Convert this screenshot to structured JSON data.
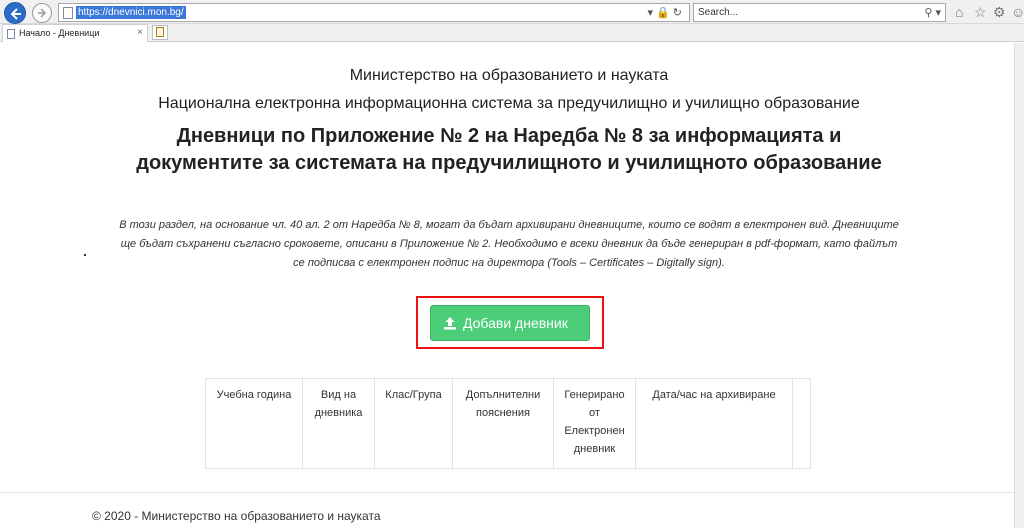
{
  "browser": {
    "url": "https://dnevnici.mon.bg/",
    "search_placeholder": "Search...",
    "tab_title": "Начало - Дневници",
    "tab_close": "×"
  },
  "page": {
    "ministry": "Министерство на образованието и науката",
    "system": "Национална електронна информационна система за предучилищно и училищно образование",
    "heading_line1": "Дневници по Приложение № 2 на Наредба № 8 за информацията и",
    "heading_line2": "документите за системата на предучилищното и училищното образование",
    "desc_line1": "В този раздел, на основание чл. 40 ал. 2 от Наредба № 8, могат да бъдат архивирани дневниците, които се водят в електронен вид. Дневниците",
    "desc_line2": "ще бъдат съхранени съгласно сроковете, описани в Приложение № 2. Необходимо е всеки дневник да бъде генериран в pdf-формат, като файлът",
    "desc_line3": "се подписва с електронен подпис на директора (Tools – Certificates – Digitally sign).",
    "add_button": "Добави дневник"
  },
  "table": {
    "columns": [
      "Учебна година",
      "Вид на дневника",
      "Клас/Група",
      "Допълнителни пояснения",
      "Генерирано от Електронен дневник",
      "Дата/час на архивиране",
      ""
    ]
  },
  "footer": {
    "text": "© 2020 - Министерство на образованието и науката"
  },
  "colors": {
    "button_bg": "#4ccd78",
    "highlight": "#ee1111",
    "url_selection": "#3b77d8"
  }
}
